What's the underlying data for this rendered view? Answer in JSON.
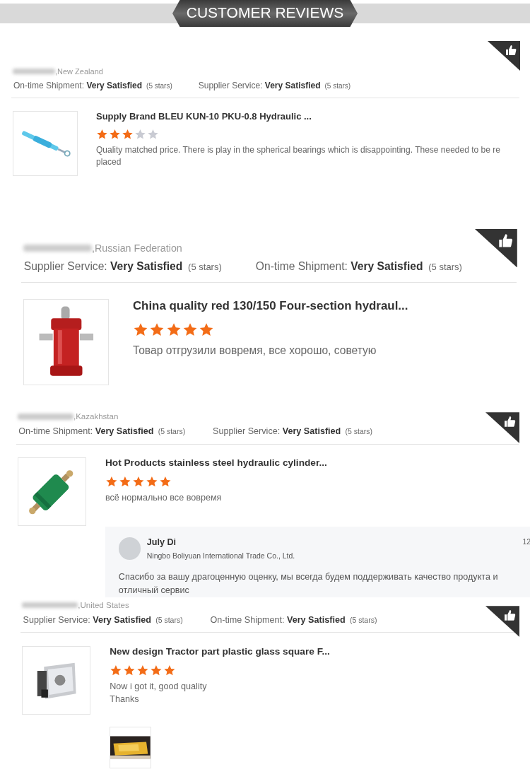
{
  "header": {
    "title": "CUSTOMER REVIEWS"
  },
  "reviews": [
    {
      "country": ",New Zealand",
      "ratings": [
        {
          "label": "On-time Shipment:",
          "value": "Very Satisfied",
          "stars_text": "(5 stars)"
        },
        {
          "label": "Supplier Service:",
          "value": "Very Satisfied",
          "stars_text": "(5 stars)"
        }
      ],
      "product": {
        "title": "Supply Brand BLEU KUN-10 PKU-0.8 Hydraulic ...",
        "stars": 3,
        "comment": "Quality matched price. There is play in the spherical bearings which is disappointing. These needed to be re placed"
      }
    },
    {
      "country": ",Russian Federation",
      "ratings": [
        {
          "label": "Supplier Service:",
          "value": "Very Satisfied",
          "stars_text": "(5 stars)"
        },
        {
          "label": "On-time Shipment:",
          "value": "Very Satisfied",
          "stars_text": "(5 stars)"
        }
      ],
      "product": {
        "title": "China quality red 130/150 Four-section hydraul...",
        "stars": 5,
        "comment": "Товар отгрузили вовремя, все хорошо, советую"
      }
    },
    {
      "country": ",Kazakhstan",
      "ratings": [
        {
          "label": "On-time Shipment:",
          "value": "Very Satisfied",
          "stars_text": "(5 stars)"
        },
        {
          "label": "Supplier Service:",
          "value": "Very Satisfied",
          "stars_text": "(5 stars)"
        }
      ],
      "product": {
        "title": "Hot Products stainless steel hydraulic cylinder...",
        "stars": 5,
        "comment": "всё нормально все вовремя"
      },
      "reply": {
        "author": "July Di",
        "company": "Ningbo Boliyuan International Trade Co., Ltd.",
        "date": "12",
        "text": "Спасибо за вашу драгоценную оценку, мы всегда будем поддерживать качество продукта и отличный сервис"
      }
    },
    {
      "country": ",United States",
      "ratings": [
        {
          "label": "Supplier Service:",
          "value": "Very Satisfied",
          "stars_text": "(5 stars)"
        },
        {
          "label": "On-time Shipment:",
          "value": "Very Satisfied",
          "stars_text": "(5 stars)"
        }
      ],
      "product": {
        "title": "New design Tractor part plastic glass square F...",
        "stars": 5,
        "comment": "Now i got it, good quality\nThanks"
      }
    }
  ]
}
